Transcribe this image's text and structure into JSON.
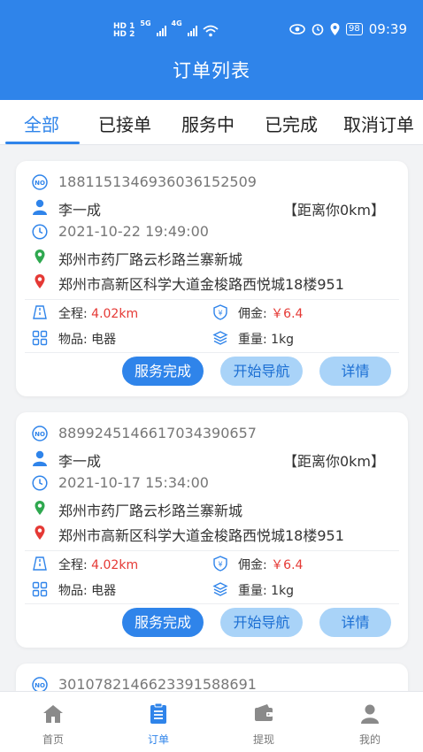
{
  "status_bar": {
    "hd1": "HD 1",
    "hd2": "HD 2",
    "net1": "5G",
    "net2": "4G",
    "battery": "98",
    "time": "09:39"
  },
  "header": {
    "title": "订单列表"
  },
  "tabs": [
    {
      "label": "全部",
      "active": true
    },
    {
      "label": "已接单",
      "active": false
    },
    {
      "label": "服务中",
      "active": false
    },
    {
      "label": "已完成",
      "active": false
    },
    {
      "label": "取消订单",
      "active": false
    }
  ],
  "orders": [
    {
      "order_no": "18811513469360361525​09",
      "customer": "李一成",
      "distance": "【距离你0km】",
      "datetime": "2021-10-22 19:49:00",
      "from": "郑州市药厂路云杉路兰寨新城",
      "to": "郑州市高新区科学大道金梭路西悦城18楼951",
      "distance_label": "全程:",
      "distance_value": "4.02km",
      "fee_label": "佣金:",
      "fee_value": "￥6.4",
      "item_label": "物品:",
      "item_value": "电器",
      "weight_label": "重量:",
      "weight_value": "1kg",
      "btn_complete": "服务完成",
      "btn_nav": "开始导航",
      "btn_detail": "详情"
    },
    {
      "order_no": "889924514661703439065​7",
      "customer": "李一成",
      "distance": "【距离你0km】",
      "datetime": "2021-10-17 15:34:00",
      "from": "郑州市药厂路云杉路兰寨新城",
      "to": "郑州市高新区科学大道金梭路西悦城18楼951",
      "distance_label": "全程:",
      "distance_value": "4.02km",
      "fee_label": "佣金:",
      "fee_value": "￥6.4",
      "item_label": "物品:",
      "item_value": "电器",
      "weight_label": "重量:",
      "weight_value": "1kg",
      "btn_complete": "服务完成",
      "btn_nav": "开始导航",
      "btn_detail": "详情"
    },
    {
      "order_no": "3010782146623391588691"
    }
  ],
  "tabbar": [
    {
      "label": "首页",
      "icon": "home-icon",
      "active": false
    },
    {
      "label": "订单",
      "icon": "order-list-icon",
      "active": true
    },
    {
      "label": "提现",
      "icon": "wallet-icon",
      "active": false
    },
    {
      "label": "我的",
      "icon": "profile-icon",
      "active": false
    }
  ],
  "colors": {
    "primary": "#2f84ea",
    "accent_light": "#a9d3f8",
    "price_red": "#e53935"
  }
}
